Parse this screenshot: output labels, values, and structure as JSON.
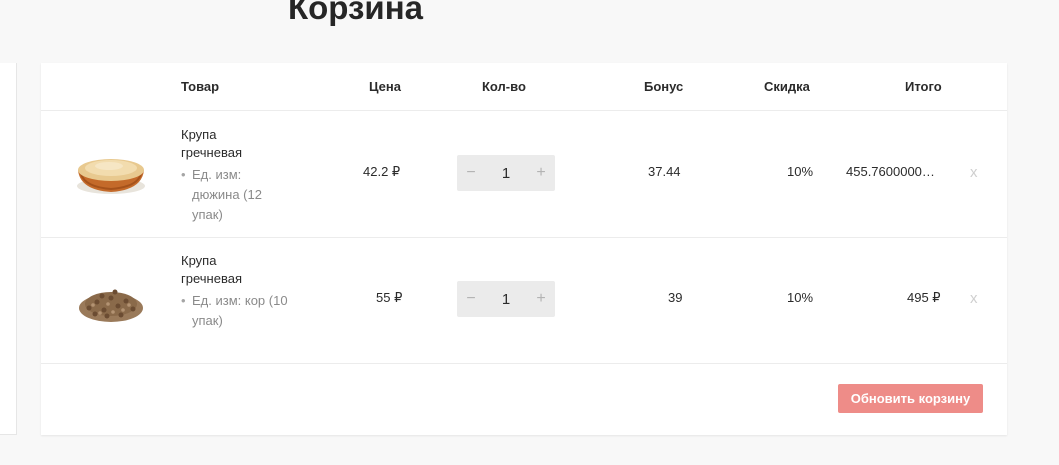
{
  "page": {
    "title": "Корзина"
  },
  "table": {
    "headers": {
      "product": "Товар",
      "price": "Цена",
      "qty": "Кол-во",
      "bonus": "Бонус",
      "discount": "Скидка",
      "total": "Итого"
    }
  },
  "items": [
    {
      "name": "Крупа гречневая",
      "unit": "Ед. изм: дюжина (12 упак)",
      "price": "42.2 ₽",
      "qty": "1",
      "bonus": "37.44",
      "discount": "10%",
      "total": "455.7600000…",
      "remove_label": "x",
      "image": "semolina-bowl-image"
    },
    {
      "name": "Крупа гречневая",
      "unit": "Ед. изм: кор (10 упак)",
      "price": "55 ₽",
      "qty": "1",
      "bonus": "39",
      "discount": "10%",
      "total": "495 ₽",
      "remove_label": "x",
      "image": "buckwheat-pile-image"
    }
  ],
  "qty_controls": {
    "minus": "−",
    "plus": "+"
  },
  "actions": {
    "update_cart": "Обновить корзину"
  },
  "colors": {
    "accent_button": "#ee8c88",
    "background": "#f8f8f8"
  }
}
